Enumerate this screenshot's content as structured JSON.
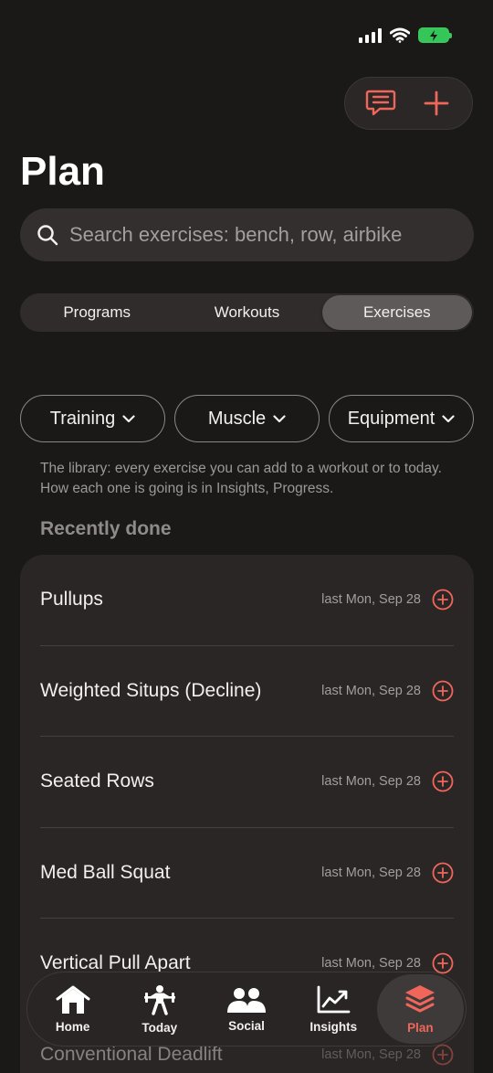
{
  "colors": {
    "accent": "#f0665a",
    "background": "#1b1918",
    "card": "#2a2625"
  },
  "status_bar": {
    "icons": [
      "signal-icon",
      "wifi-icon",
      "battery-charging-icon"
    ]
  },
  "header": {
    "title": "Plan",
    "actions": [
      "message-icon",
      "plus-icon"
    ]
  },
  "search": {
    "placeholder": "Search exercises: bench, row, airbike"
  },
  "segments": [
    {
      "label": "Programs",
      "active": false
    },
    {
      "label": "Workouts",
      "active": false
    },
    {
      "label": "Exercises",
      "active": true
    }
  ],
  "filters": [
    {
      "label": "Training"
    },
    {
      "label": "Muscle"
    },
    {
      "label": "Equipment"
    }
  ],
  "description": "The library: every exercise you can add to a workout or to today. How each one is going is in Insights, Progress.",
  "recent": {
    "title": "Recently done",
    "items": [
      {
        "name": "Pullups",
        "date": "last Mon, Sep 28"
      },
      {
        "name": "Weighted Situps (Decline)",
        "date": "last Mon, Sep 28"
      },
      {
        "name": "Seated Rows",
        "date": "last Mon, Sep 28"
      },
      {
        "name": "Med Ball Squat",
        "date": "last Mon, Sep 28"
      },
      {
        "name": "Vertical Pull Apart",
        "date": "last Mon, Sep 28"
      },
      {
        "name": "Conventional Deadlift",
        "date": "last Mon, Sep 28"
      }
    ]
  },
  "tabbar": [
    {
      "label": "Home",
      "icon": "home-icon",
      "active": false
    },
    {
      "label": "Today",
      "icon": "weightlifter-icon",
      "active": false
    },
    {
      "label": "Social",
      "icon": "people-icon",
      "active": false
    },
    {
      "label": "Insights",
      "icon": "chart-icon",
      "active": false
    },
    {
      "label": "Plan",
      "icon": "layers-icon",
      "active": true
    }
  ]
}
